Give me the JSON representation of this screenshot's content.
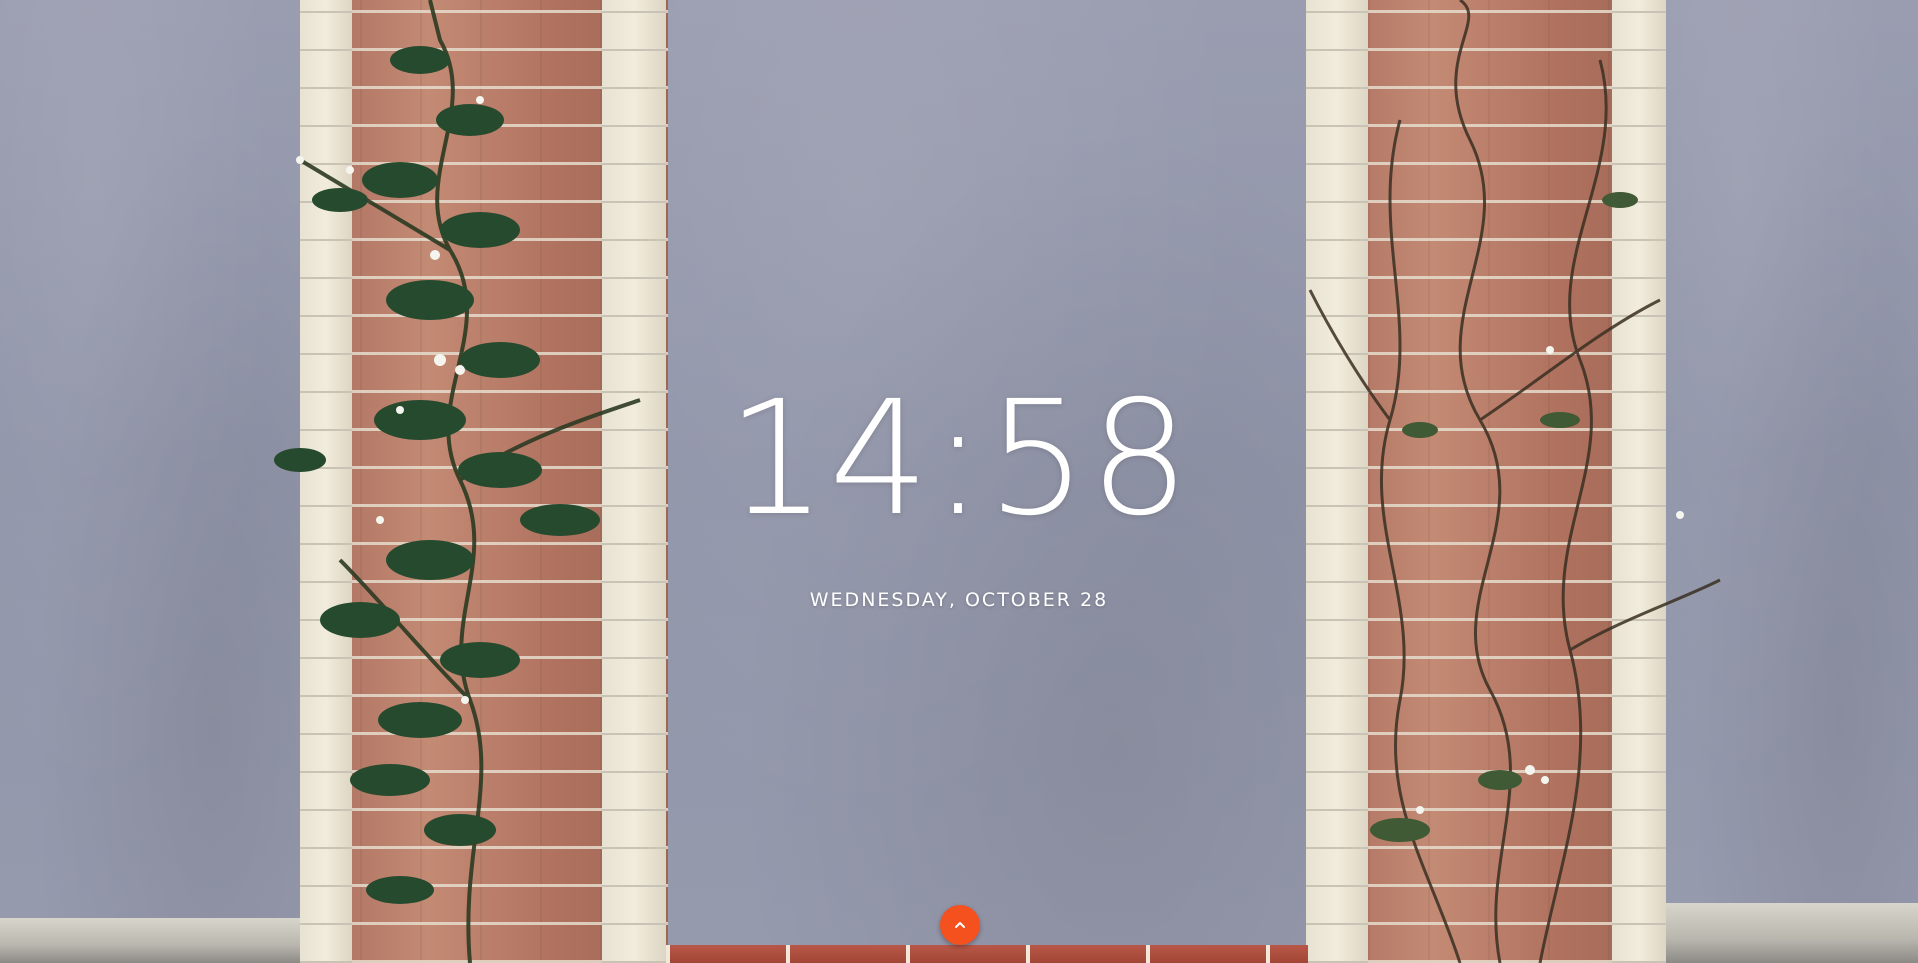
{
  "clock": {
    "time": "14:58",
    "date": "WEDNESDAY, OCTOBER 28"
  },
  "controls": {
    "expand_icon": "chevron-up-icon",
    "accent_color": "#f4511e"
  },
  "background": {
    "description_icon": "wallpaper-image"
  }
}
